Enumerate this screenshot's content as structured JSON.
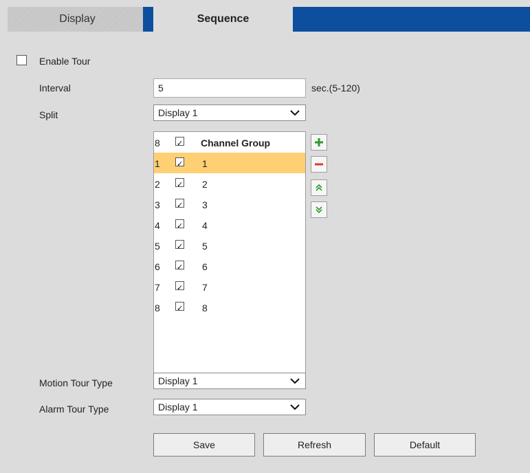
{
  "tabs": {
    "display_label": "Display",
    "sequence_label": "Sequence"
  },
  "form": {
    "enable_tour_label": "Enable Tour",
    "enable_tour_checked": false,
    "interval_label": "Interval",
    "interval_value": "5",
    "interval_hint": "sec.(5-120)",
    "split_label": "Split",
    "split_value": "Display 1",
    "motion_tour_label": "Motion Tour Type",
    "motion_tour_value": "Display 1",
    "alarm_tour_label": "Alarm Tour Type",
    "alarm_tour_value": "Display 1"
  },
  "channel_list": {
    "header": {
      "num": "8",
      "label": "Channel Group",
      "checked": true
    },
    "rows": [
      {
        "num": "1",
        "label": "1",
        "checked": true,
        "selected": true
      },
      {
        "num": "2",
        "label": "2",
        "checked": true,
        "selected": false
      },
      {
        "num": "3",
        "label": "3",
        "checked": true,
        "selected": false
      },
      {
        "num": "4",
        "label": "4",
        "checked": true,
        "selected": false
      },
      {
        "num": "5",
        "label": "5",
        "checked": true,
        "selected": false
      },
      {
        "num": "6",
        "label": "6",
        "checked": true,
        "selected": false
      },
      {
        "num": "7",
        "label": "7",
        "checked": true,
        "selected": false
      },
      {
        "num": "8",
        "label": "8",
        "checked": true,
        "selected": false
      }
    ]
  },
  "side_buttons": {
    "add_icon": "plus-icon",
    "remove_icon": "minus-icon",
    "up_icon": "double-chevron-up-icon",
    "down_icon": "double-chevron-down-icon"
  },
  "buttons": {
    "save_label": "Save",
    "refresh_label": "Refresh",
    "default_label": "Default"
  },
  "colors": {
    "tab_accent": "#0d4f9e",
    "selected_row": "#ffcf74",
    "add_green": "#2e9b2e",
    "remove_red": "#d63a3a"
  }
}
